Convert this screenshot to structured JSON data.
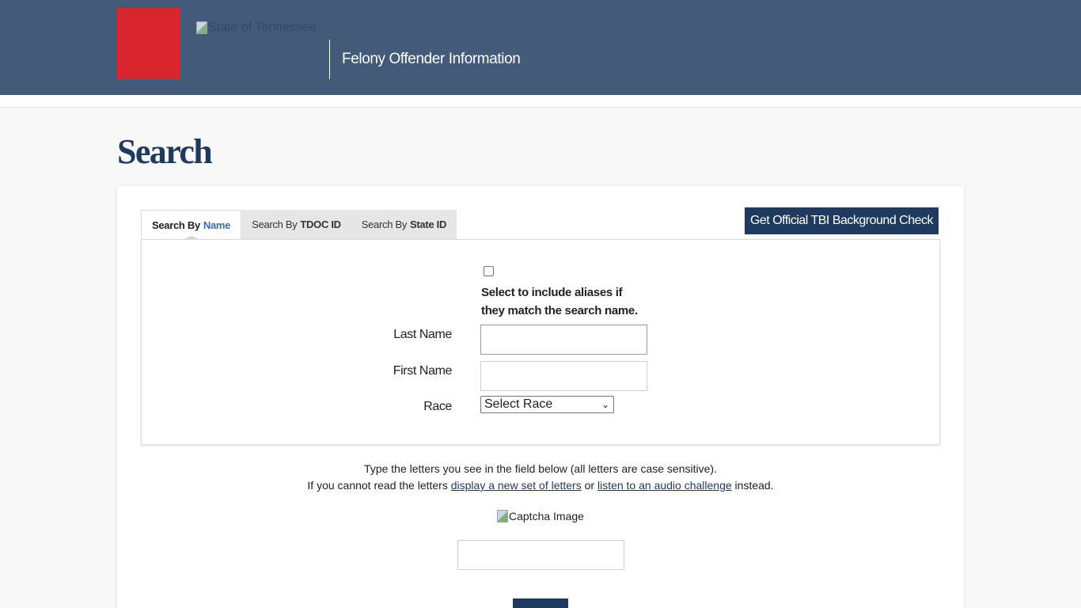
{
  "header": {
    "state_logo_alt": "State of Tennessee",
    "app_title": "Felony Offender Information"
  },
  "page": {
    "title": "Search"
  },
  "tabs": [
    {
      "prefix": "Search By",
      "emphasis": "Name",
      "active": true
    },
    {
      "prefix": "Search By",
      "emphasis": "TDOC ID",
      "active": false
    },
    {
      "prefix": "Search By",
      "emphasis": "State ID",
      "active": false
    }
  ],
  "tbi_button": {
    "label": "Get Official TBI Background Check"
  },
  "form": {
    "alias_checkbox": {
      "checked": false,
      "label": "Select to include aliases if they match the search name."
    },
    "last_name": {
      "label": "Last Name",
      "value": ""
    },
    "first_name": {
      "label": "First Name",
      "value": ""
    },
    "race": {
      "label": "Race",
      "selected": "Select Race"
    }
  },
  "captcha": {
    "instruction": "Type the letters you see in the field below (all letters are case sensitive).",
    "help_prefix": "If you cannot read the letters",
    "new_letters_link": "display a new set of letters",
    "help_or": "or",
    "audio_link": "listen to an audio challenge",
    "help_suffix": "instead.",
    "image_alt": "Captcha Image",
    "value": ""
  },
  "colors": {
    "header_bg": "#445a79",
    "logo_red": "#d9262e",
    "brand_navy": "#1f3a5f",
    "active_tab_accent": "#3a6ea5"
  }
}
